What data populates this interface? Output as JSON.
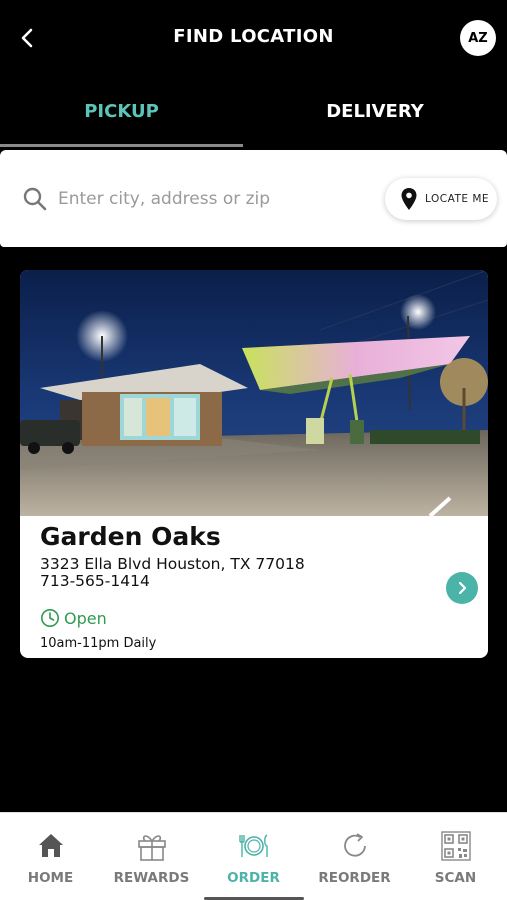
{
  "header": {
    "title": "FIND LOCATION",
    "avatar_initials": "AZ"
  },
  "tabs": [
    {
      "label": "PICKUP",
      "active": true
    },
    {
      "label": "DELIVERY",
      "active": false
    }
  ],
  "search": {
    "placeholder": "Enter city, address or zip",
    "value": "",
    "locate_label": "LOCATE ME"
  },
  "location": {
    "name": "Garden Oaks",
    "address": "3323 Ella Blvd Houston, TX 77018",
    "phone": "713-565-1414",
    "status": "Open",
    "hours": "10am-11pm Daily"
  },
  "nav": [
    {
      "label": "HOME",
      "icon": "home-icon",
      "active": false
    },
    {
      "label": "REWARDS",
      "icon": "gift-icon",
      "active": false
    },
    {
      "label": "ORDER",
      "icon": "plate-cutlery-icon",
      "active": true
    },
    {
      "label": "REORDER",
      "icon": "refresh-icon",
      "active": false
    },
    {
      "label": "SCAN",
      "icon": "qr-code-icon",
      "active": false
    }
  ],
  "colors": {
    "accent": "#4bb3a8",
    "tab_active": "#5cc4b8",
    "open_green": "#2e9b50",
    "background": "#000000"
  }
}
